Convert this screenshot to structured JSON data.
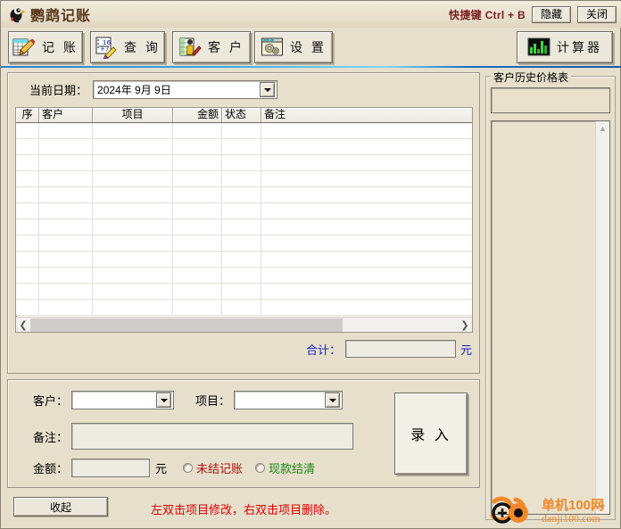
{
  "window": {
    "title": "鹦鹉记账",
    "app_icon": "parrot-icon",
    "shortcut_hint": "快捷键 Ctrl + B",
    "hide_label": "隐藏",
    "close_label": "关闭"
  },
  "toolbar": {
    "buttons": [
      {
        "label": "记 账",
        "icon": "ledger-pencil-icon"
      },
      {
        "label": "查 询",
        "icon": "query-pencil-icon"
      },
      {
        "label": "客 户",
        "icon": "customer-icon"
      },
      {
        "label": "设 置",
        "icon": "settings-gears-icon"
      },
      {
        "label": "计算器",
        "icon": "bar-chart-calculator-icon"
      }
    ]
  },
  "main": {
    "date_label": "当前日期：",
    "date_value": "2024年 9月 9日",
    "grid": {
      "columns": [
        "序",
        "客户",
        "项目",
        "金额",
        "状态",
        "备注"
      ],
      "rows": []
    },
    "total_label": "合计：",
    "total_value": "",
    "total_unit": "元"
  },
  "form": {
    "customer_label": "客户：",
    "customer_value": "",
    "item_label": "项目：",
    "item_value": "",
    "note_label": "备注：",
    "note_value": "",
    "amount_label": "金额：",
    "amount_value": "",
    "amount_unit": "元",
    "radio_unpaid": "未结记账",
    "radio_paid": "现款结清",
    "submit_label": "录 入"
  },
  "bottom": {
    "collapse_label": "收起",
    "hint": "左双击项目修改，右双击项目删除。"
  },
  "right_panel": {
    "group_title": "客户历史价格表",
    "field_value": "",
    "list_items": []
  },
  "watermark": {
    "cn": "单机100网",
    "en": "danji100.com"
  },
  "colors": {
    "background": "#e6dfcb",
    "accent_blue": "#1522c8",
    "hint_red": "#e00000",
    "unpaid_red": "#b01010",
    "paid_green": "#1a8a1a",
    "title_brown": "#5a3a1e",
    "watermark_orange": "#f08a2a"
  }
}
